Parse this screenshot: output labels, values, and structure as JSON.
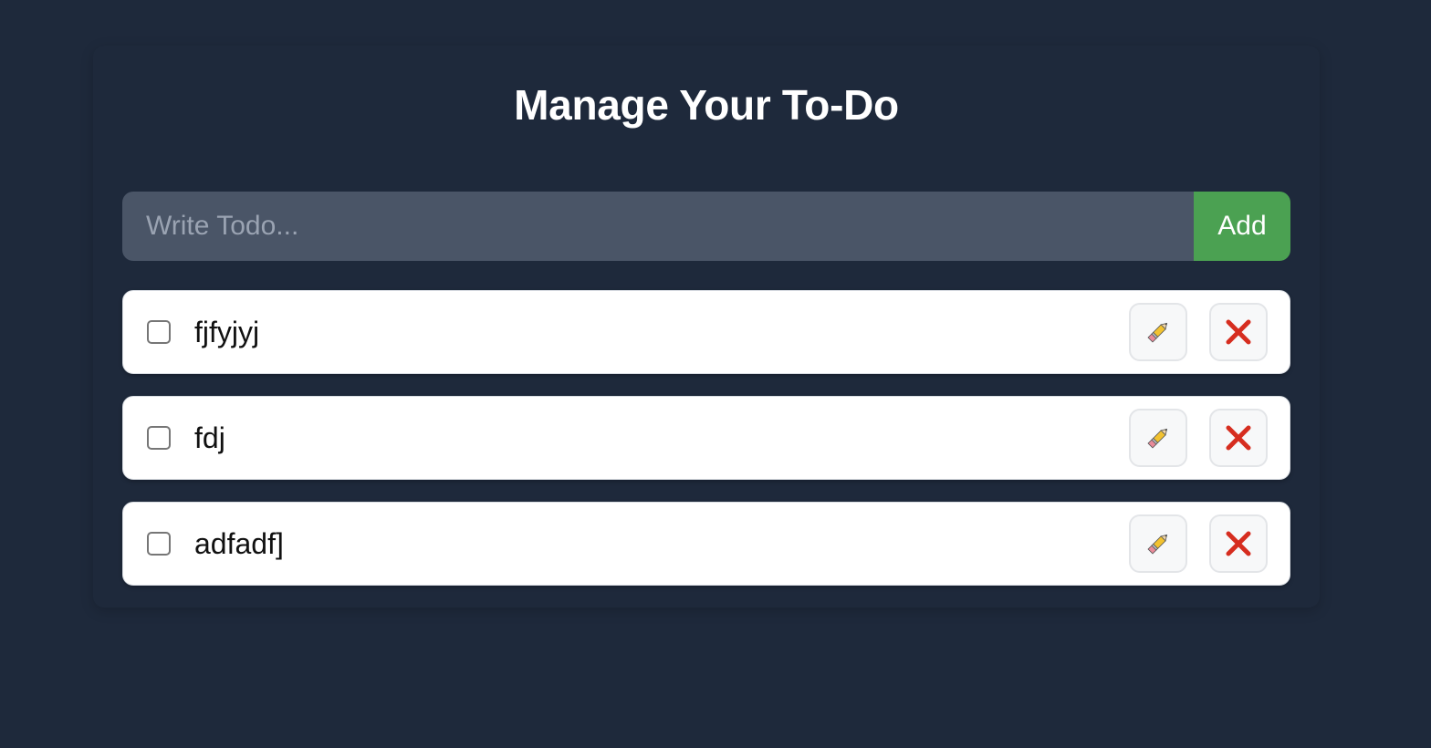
{
  "header": {
    "title": "Manage Your To-Do"
  },
  "add_form": {
    "placeholder": "Write Todo...",
    "value": "",
    "add_label": "Add"
  },
  "todos": [
    {
      "text": "fjfyjyj",
      "done": false
    },
    {
      "text": "fdj",
      "done": false
    },
    {
      "text": "adfadf]",
      "done": false
    }
  ],
  "icons": {
    "edit": "pencil-icon",
    "delete": "close-icon"
  },
  "colors": {
    "background": "#1e293b",
    "input": "#4a5567",
    "accent_green": "#4ba152",
    "delete_red": "#d62d1f"
  }
}
